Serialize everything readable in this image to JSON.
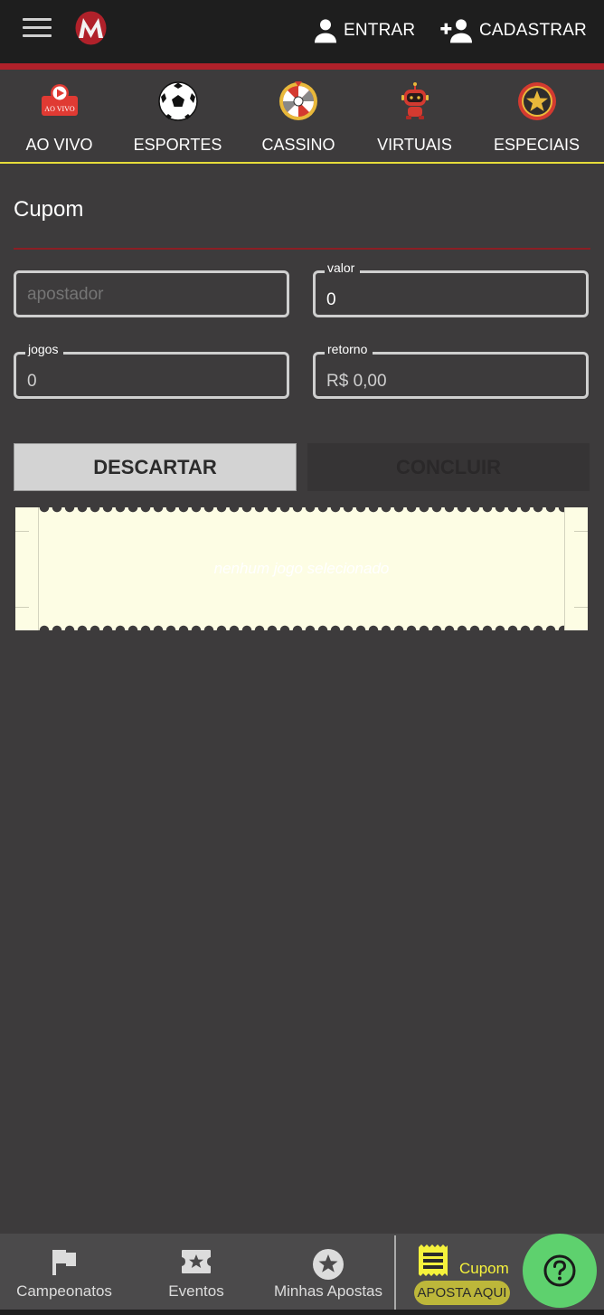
{
  "header": {
    "menu_icon": "hamburger-icon",
    "logo": "M",
    "login_label": "ENTRAR",
    "register_label": "CADASTRAR",
    "colors": {
      "bar": "#1e1e1e",
      "accent_red": "#b0212a"
    }
  },
  "categories": [
    {
      "label": "AO VIVO",
      "icon": "live-icon",
      "badge_text": "AO VIVO"
    },
    {
      "label": "ESPORTES",
      "icon": "soccer-ball-icon"
    },
    {
      "label": "CASSINO",
      "icon": "roulette-wheel-icon"
    },
    {
      "label": "VIRTUAIS",
      "icon": "robot-icon"
    },
    {
      "label": "ESPECIAIS",
      "icon": "star-badge-icon"
    }
  ],
  "cupom": {
    "title": "Cupom",
    "fields": {
      "apostador": {
        "label": "",
        "value": "",
        "placeholder": "apostador"
      },
      "valor": {
        "label": "valor",
        "value": "0"
      },
      "jogos": {
        "label": "jogos",
        "value": "0"
      },
      "retorno": {
        "label": "retorno",
        "value": "R$ 0,00"
      }
    },
    "buttons": {
      "discard": "DESCARTAR",
      "conclude": "CONCLUIR"
    },
    "ticket_message": "nenhum jogo selecionado"
  },
  "bottom_nav": {
    "items": [
      {
        "label": "Campeonatos",
        "icon": "flag-icon"
      },
      {
        "label": "Eventos",
        "icon": "ticket-star-icon"
      },
      {
        "label": "Minhas Apostas",
        "icon": "star-circle-icon"
      }
    ],
    "cupom": {
      "label": "Cupom",
      "pill": "APOSTA AQUI",
      "icon": "receipt-icon",
      "color": "#f5f23c"
    },
    "help": {
      "icon": "help-icon",
      "color": "#5ed16e"
    }
  }
}
